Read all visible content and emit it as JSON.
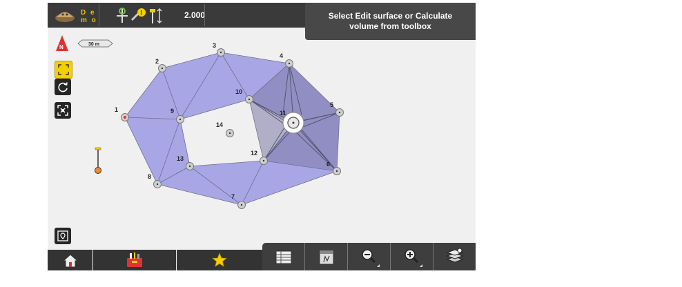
{
  "topbar": {
    "logo_text_line1": "D e",
    "logo_text_line2": "m o",
    "antenna_height": "2.000"
  },
  "toast": {
    "message": "Select Edit surface or Calculate volume from toolbox"
  },
  "map": {
    "scale_label": "30 m",
    "north_label": "N",
    "points": [
      {
        "id": "1"
      },
      {
        "id": "2"
      },
      {
        "id": "3"
      },
      {
        "id": "4"
      },
      {
        "id": "5"
      },
      {
        "id": "6"
      },
      {
        "id": "7"
      },
      {
        "id": "8"
      },
      {
        "id": "9"
      },
      {
        "id": "10"
      },
      {
        "id": "11"
      },
      {
        "id": "12"
      },
      {
        "id": "13"
      },
      {
        "id": "14"
      }
    ],
    "surface_color": "#a9a6e6",
    "edge_color": "#6d6d8a",
    "selected_point": "11"
  },
  "left_tools": [
    {
      "icon": "zoom-extents-icon"
    },
    {
      "icon": "refresh-icon"
    },
    {
      "icon": "center-target-icon"
    },
    {
      "icon": "map-layers-icon"
    }
  ],
  "bottombar": [
    {
      "icon": "home-icon"
    },
    {
      "icon": "toolbox-icon"
    },
    {
      "icon": "favorites-star-icon"
    }
  ],
  "toolbox": [
    {
      "icon": "point-list-icon"
    },
    {
      "icon": "edit-surface-icon"
    },
    {
      "icon": "zoom-out-icon"
    },
    {
      "icon": "zoom-in-icon"
    },
    {
      "icon": "layers-icon"
    }
  ],
  "colors": {
    "accent_yellow": "#f5d000",
    "north_red": "#e03030",
    "bar_dark": "#3a3a3a"
  }
}
